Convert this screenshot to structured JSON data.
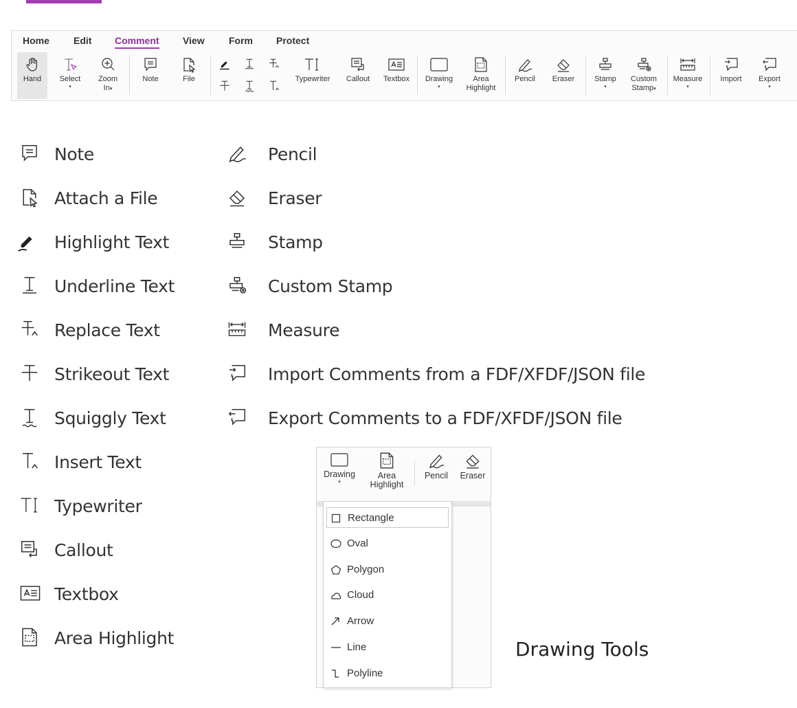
{
  "colors": {
    "accent": "#a33bb3",
    "accent_dark": "#8e2f9c"
  },
  "ribbon": {
    "tabs": [
      {
        "label": "Home"
      },
      {
        "label": "Edit"
      },
      {
        "label": "Comment"
      },
      {
        "label": "View"
      },
      {
        "label": "Form"
      },
      {
        "label": "Protect"
      }
    ],
    "active_tab": "Comment",
    "tools": {
      "hand": "Hand",
      "select": "Select",
      "zoom": [
        "Zoom",
        "In"
      ],
      "note": "Note",
      "file": "File",
      "typewriter": "Typewriter",
      "callout": "Callout",
      "textbox": "Textbox",
      "drawing": "Drawing",
      "area_highlight": [
        "Area",
        "Highlight"
      ],
      "pencil": "Pencil",
      "eraser": "Eraser",
      "stamp": "Stamp",
      "custom_stamp": [
        "Custom",
        "Stamp"
      ],
      "measure": "Measure",
      "import": "Import",
      "export": "Export"
    },
    "caret": "▾"
  },
  "legend_left": [
    {
      "icon": "note-icon",
      "label": "Note"
    },
    {
      "icon": "attach-file-icon",
      "label": "Attach a File"
    },
    {
      "icon": "highlight-icon",
      "label": "Highlight Text"
    },
    {
      "icon": "underline-icon",
      "label": "Underline Text"
    },
    {
      "icon": "replace-text-icon",
      "label": "Replace Text"
    },
    {
      "icon": "strikeout-icon",
      "label": "Strikeout Text"
    },
    {
      "icon": "squiggly-icon",
      "label": "Squiggly Text"
    },
    {
      "icon": "insert-text-icon",
      "label": "Insert Text"
    },
    {
      "icon": "typewriter-icon",
      "label": "Typewriter"
    },
    {
      "icon": "callout-icon",
      "label": "Callout"
    },
    {
      "icon": "textbox-icon",
      "label": "Textbox"
    },
    {
      "icon": "area-highlight-icon",
      "label": "Area Highlight"
    }
  ],
  "legend_right": [
    {
      "icon": "pencil-icon",
      "label": "Pencil"
    },
    {
      "icon": "eraser-icon",
      "label": "Eraser"
    },
    {
      "icon": "stamp-icon",
      "label": "Stamp"
    },
    {
      "icon": "custom-stamp-icon",
      "label": "Custom Stamp"
    },
    {
      "icon": "measure-icon",
      "label": "Measure"
    },
    {
      "icon": "import-icon",
      "label": "Import Comments from a FDF/XFDF/JSON file"
    },
    {
      "icon": "export-icon",
      "label": "Export Comments to a FDF/XFDF/JSON file"
    }
  ],
  "inset": {
    "drawing": "Drawing",
    "area_highlight": [
      "Area",
      "Highlight"
    ],
    "pencil": "Pencil",
    "eraser": "Eraser",
    "caret": "▾",
    "menu": [
      {
        "icon": "rectangle-icon",
        "label": "Rectangle"
      },
      {
        "icon": "oval-icon",
        "label": "Oval"
      },
      {
        "icon": "polygon-icon",
        "label": "Polygon"
      },
      {
        "icon": "cloud-icon",
        "label": "Cloud"
      },
      {
        "icon": "arrow-icon",
        "label": "Arrow"
      },
      {
        "icon": "line-icon",
        "label": "Line"
      },
      {
        "icon": "polyline-icon",
        "label": "Polyline"
      }
    ],
    "highlighted_item": "Rectangle"
  },
  "caption": "Drawing Tools"
}
